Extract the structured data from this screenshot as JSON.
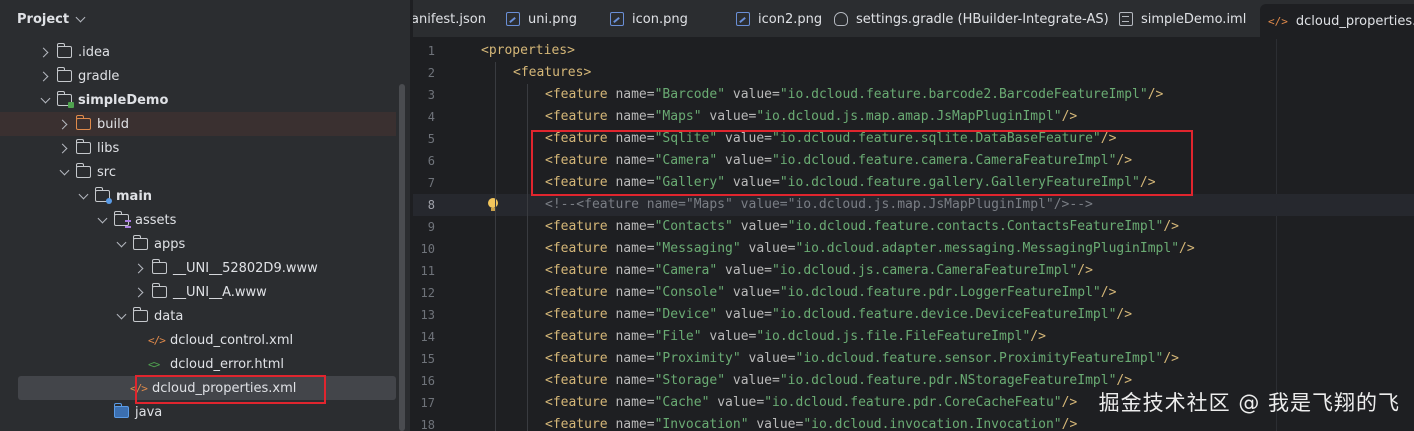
{
  "project": {
    "title": "Project",
    "tree": [
      {
        "label": ".idea",
        "arrow": "right",
        "icon": "folder",
        "level": 1
      },
      {
        "label": "gradle",
        "arrow": "right",
        "icon": "folder",
        "level": 1
      },
      {
        "label": "simpleDemo",
        "arrow": "down",
        "icon": "module-folder",
        "level": 1,
        "bold": true
      },
      {
        "label": "build",
        "arrow": "right",
        "icon": "excluded-folder",
        "level": 2,
        "highlight": true
      },
      {
        "label": "libs",
        "arrow": "right",
        "icon": "folder",
        "level": 2
      },
      {
        "label": "src",
        "arrow": "down",
        "icon": "folder",
        "level": 2
      },
      {
        "label": "main",
        "arrow": "down",
        "icon": "source-folder",
        "level": 3,
        "bold": true
      },
      {
        "label": "assets",
        "arrow": "down",
        "icon": "resource-folder",
        "level": 4
      },
      {
        "label": "apps",
        "arrow": "down",
        "icon": "folder",
        "level": 5
      },
      {
        "label": "__UNI__52802D9.www",
        "arrow": "right",
        "icon": "folder",
        "level": 6
      },
      {
        "label": "__UNI__A.www",
        "arrow": "right",
        "icon": "folder",
        "level": 6
      },
      {
        "label": "data",
        "arrow": "down",
        "icon": "folder",
        "level": 5
      },
      {
        "label": "dcloud_control.xml",
        "arrow": "none",
        "icon": "xml-file",
        "level": 6
      },
      {
        "label": "dcloud_error.html",
        "arrow": "none",
        "icon": "html-file",
        "level": 6
      },
      {
        "label": "dcloud_properties.xml",
        "arrow": "none",
        "icon": "xml-file",
        "level": 6,
        "selected": true
      },
      {
        "label": "java",
        "arrow": "none",
        "icon": "java-folder",
        "level": 4
      }
    ]
  },
  "tabs": [
    {
      "label": "anifest.json",
      "icon": "none"
    },
    {
      "label": "uni.png",
      "icon": "image"
    },
    {
      "label": "icon.png",
      "icon": "image"
    },
    {
      "label": "icon2.png",
      "icon": "image"
    },
    {
      "label": "settings.gradle (HBuilder-Integrate-AS)",
      "icon": "gradle"
    },
    {
      "label": "simpleDemo.iml",
      "icon": "iml"
    },
    {
      "label": "dcloud_properties.x",
      "icon": "xml",
      "active": true
    }
  ],
  "icons": {
    "xml": "</>",
    "html": "<>"
  },
  "code": {
    "current_line": 8,
    "lines": [
      {
        "n": 1,
        "indent": 0,
        "type": "open",
        "tag": "properties"
      },
      {
        "n": 2,
        "indent": 1,
        "type": "open",
        "tag": "features"
      },
      {
        "n": 3,
        "indent": 2,
        "type": "feature",
        "name": "Barcode",
        "value": "io.dcloud.feature.barcode2.BarcodeFeatureImpl"
      },
      {
        "n": 4,
        "indent": 2,
        "type": "feature",
        "name": "Maps",
        "value": "io.dcloud.js.map.amap.JsMapPluginImpl"
      },
      {
        "n": 5,
        "indent": 2,
        "type": "feature",
        "name": "Sqlite",
        "value": "io.dcloud.feature.sqlite.DataBaseFeature"
      },
      {
        "n": 6,
        "indent": 2,
        "type": "feature",
        "name": "Camera",
        "value": "io.dcloud.feature.camera.CameraFeatureImpl"
      },
      {
        "n": 7,
        "indent": 2,
        "type": "feature",
        "name": "Gallery",
        "value": "io.dcloud.feature.gallery.GalleryFeatureImpl"
      },
      {
        "n": 8,
        "indent": 2,
        "type": "comment",
        "text": "<!--<feature name=\"Maps\" value=\"io.dcloud.js.map.JsMapPluginImpl\"/>-->"
      },
      {
        "n": 9,
        "indent": 2,
        "type": "feature",
        "name": "Contacts",
        "value": "io.dcloud.feature.contacts.ContactsFeatureImpl"
      },
      {
        "n": 10,
        "indent": 2,
        "type": "feature",
        "name": "Messaging",
        "value": "io.dcloud.adapter.messaging.MessagingPluginImpl"
      },
      {
        "n": 11,
        "indent": 2,
        "type": "feature",
        "name": "Camera",
        "value": "io.dcloud.js.camera.CameraFeatureImpl"
      },
      {
        "n": 12,
        "indent": 2,
        "type": "feature",
        "name": "Console",
        "value": "io.dcloud.feature.pdr.LoggerFeatureImpl"
      },
      {
        "n": 13,
        "indent": 2,
        "type": "feature",
        "name": "Device",
        "value": "io.dcloud.feature.device.DeviceFeatureImpl"
      },
      {
        "n": 14,
        "indent": 2,
        "type": "feature",
        "name": "File",
        "value": "io.dcloud.js.file.FileFeatureImpl"
      },
      {
        "n": 15,
        "indent": 2,
        "type": "feature",
        "name": "Proximity",
        "value": "io.dcloud.feature.sensor.ProximityFeatureImpl"
      },
      {
        "n": 16,
        "indent": 2,
        "type": "feature",
        "name": "Storage",
        "value": "io.dcloud.feature.pdr.NStorageFeatureImpl"
      },
      {
        "n": 17,
        "indent": 2,
        "type": "feature",
        "name": "Cache",
        "value": "io.dcloud.feature.pdr.CoreCacheFeatu"
      },
      {
        "n": 18,
        "indent": 2,
        "type": "feature",
        "name": "Invocation",
        "value": "io.dcloud.invocation.Invocation"
      }
    ]
  },
  "watermark": "掘金技术社区 @ 我是飞翔的飞",
  "colors": {
    "annotation": "#e0252e",
    "tag": "#d5b778",
    "value": "#6aab73",
    "comment": "#7a7e85"
  }
}
